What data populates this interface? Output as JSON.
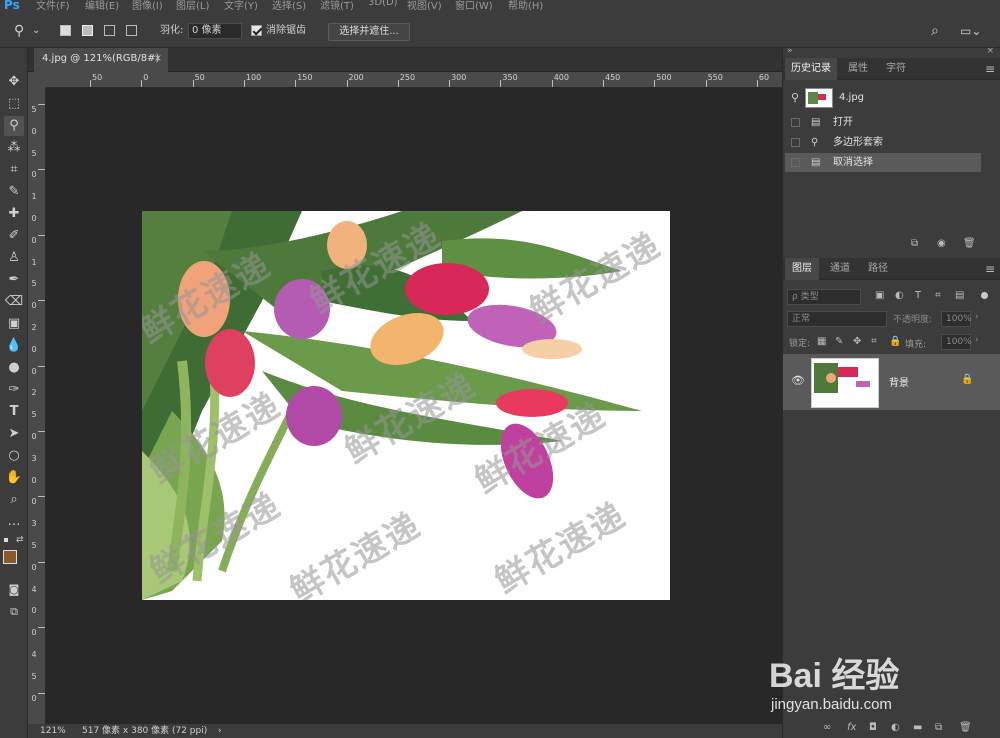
{
  "app": {
    "logo": "Ps"
  },
  "menus": [
    "文件(F)",
    "编辑(E)",
    "图像(I)",
    "图层(L)",
    "文字(Y)",
    "选择(S)",
    "滤镜(T)",
    "3D(D)",
    "视图(V)",
    "窗口(W)",
    "帮助(H)"
  ],
  "options": {
    "feather_label": "羽化:",
    "feather_value": "0 像素",
    "antialias_label": "消除锯齿",
    "select_mask_button": "选择并遮住..."
  },
  "document": {
    "tab_title": "4.jpg @ 121%(RGB/8#)",
    "close": "×",
    "zoom": "121%",
    "info": "517 像素 x 380 像素 (72 ppi)",
    "watermark": "鲜花速递"
  },
  "rulers": {
    "h": [
      "50",
      "0",
      "50",
      "100",
      "150",
      "200",
      "250",
      "300",
      "350",
      "400",
      "450",
      "500",
      "550",
      "60"
    ],
    "v": [
      "5",
      "0",
      "5",
      "0",
      "1",
      "0",
      "0",
      "1",
      "5",
      "0",
      "2",
      "0",
      "0",
      "2",
      "5",
      "0",
      "3",
      "0",
      "0",
      "3",
      "5",
      "0",
      "4",
      "0",
      "0",
      "4",
      "5",
      "0"
    ]
  },
  "history_panel": {
    "tabs": [
      "历史记录",
      "属性",
      "字符"
    ],
    "snapshot": "4.jpg",
    "items": [
      "打开",
      "多边形套索",
      "取消选择"
    ]
  },
  "layers_panel": {
    "tabs": [
      "图层",
      "通道",
      "路径"
    ],
    "kind_filter": "ρ 类型",
    "blend_mode": "正常",
    "opacity_label": "不透明度:",
    "opacity_value": "100%",
    "lock_label": "锁定:",
    "fill_label": "填充:",
    "fill_value": "100%",
    "layer_name": "背景"
  },
  "branding": {
    "logo": "Bai 经验",
    "url": "jingyan.baidu.com"
  },
  "colors": {
    "foreground": "#8b5a2b",
    "background": "#3a8ee6"
  }
}
